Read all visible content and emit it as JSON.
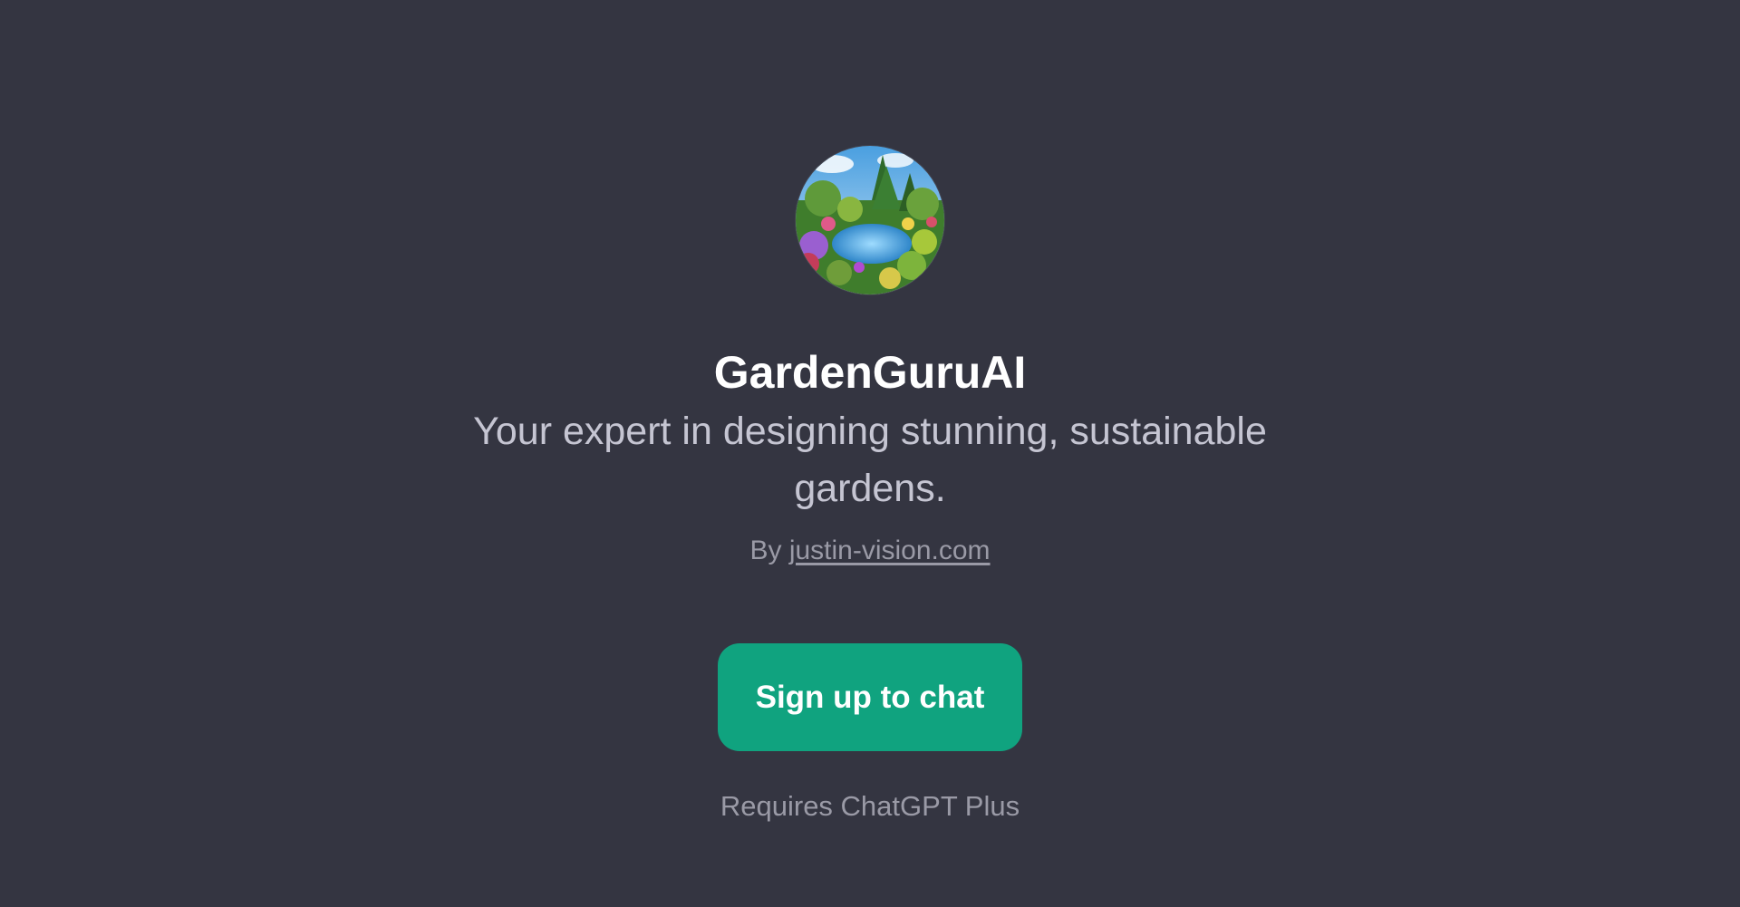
{
  "gpt": {
    "avatar_icon": "garden-pond-icon",
    "name": "GardenGuruAI",
    "description": "Your expert in designing stunning, sustainable gardens.",
    "author_prefix": "By",
    "author_link": "justin-vision.com"
  },
  "cta": {
    "signup_label": "Sign up to chat",
    "requirement": "Requires ChatGPT Plus"
  },
  "colors": {
    "background": "#343541",
    "accent": "#10a37f",
    "title": "#ffffff",
    "description": "#c5c5d2",
    "muted": "#9a9aa6"
  }
}
